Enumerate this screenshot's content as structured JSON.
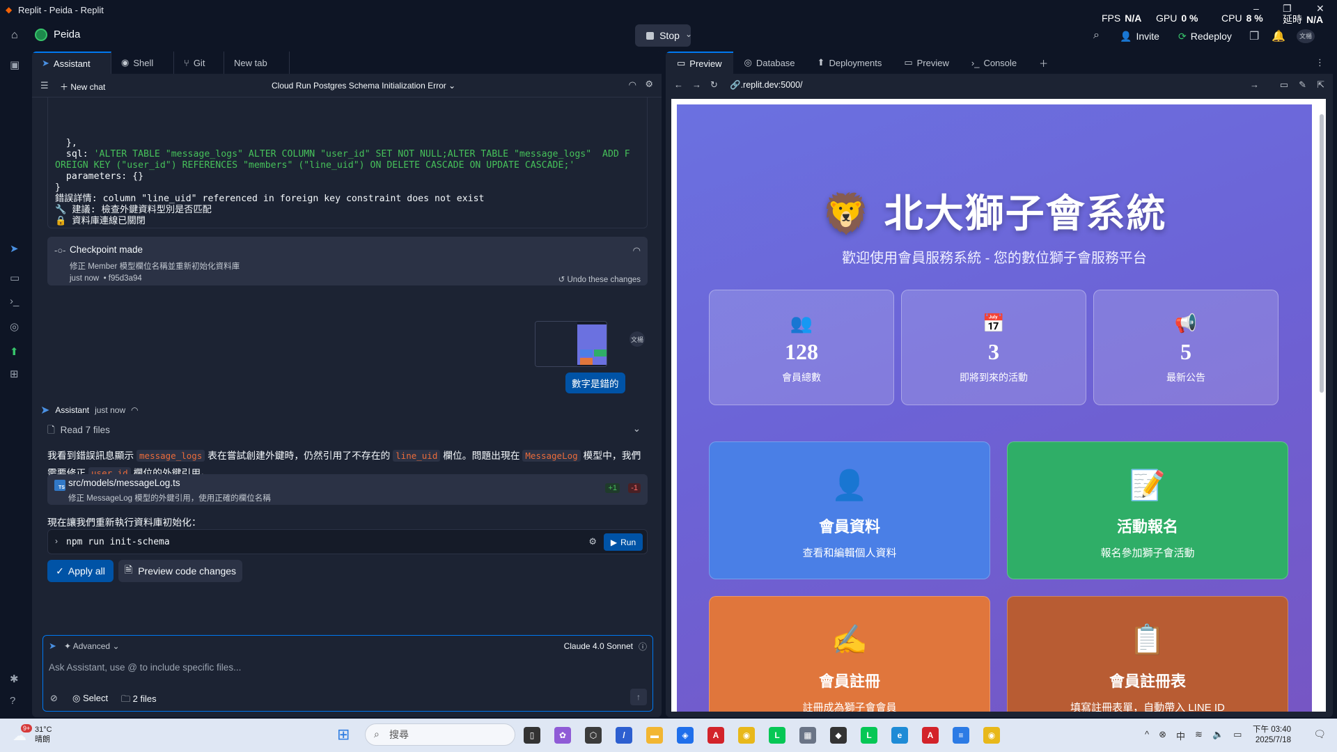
{
  "window": {
    "title": "Replit - Peida - Replit",
    "perf": [
      {
        "label": "FPS",
        "value": "N/A"
      },
      {
        "label": "GPU",
        "value": "0 %"
      },
      {
        "label": "CPU",
        "value": "8 %"
      },
      {
        "label": "延時",
        "value": "N/A"
      }
    ]
  },
  "header": {
    "repl_name": "Peida",
    "stop_label": "Stop",
    "invite_label": "Invite",
    "redeploy_label": "Redeploy",
    "avatar_text": "文楊"
  },
  "left": {
    "tabs": [
      {
        "label": "Assistant",
        "icon": "assistant-icon",
        "active": true
      },
      {
        "label": "Shell",
        "icon": "shell-icon"
      },
      {
        "label": "Git",
        "icon": "git-icon"
      },
      {
        "label": "New tab",
        "icon": ""
      }
    ],
    "new_chat": "New chat",
    "chat_title": "Cloud Run Postgres Schema Initialization Error",
    "code_lines": [
      "  },",
      "  sql: ",
      "'ALTER TABLE \"message_logs\" ALTER COLUMN \"user_id\" SET NOT NULL;ALTER TABLE \"message_logs\"  ADD F",
      "OREIGN KEY (\"user_id\") REFERENCES \"members\" (\"line_uid\") ON DELETE CASCADE ON UPDATE CASCADE;'",
      "  parameters: {}",
      "}",
      "錯誤詳情: column \"line_uid\" referenced in foreign key constraint does not exist",
      "🔧 建議: 檢查外鍵資料型別是否匹配",
      "🔒 資料庫連線已關閉"
    ],
    "checkpoint": {
      "title": "Checkpoint made",
      "desc": "修正 Member 模型欄位名稱並重新初始化資料庫",
      "time": "just now",
      "hash": "• f95d3a94",
      "undo": "Undo these changes"
    },
    "user_avatar": "文楊",
    "user_message": "數字是錯的",
    "assistant_name": "Assistant",
    "assistant_time": "just now",
    "read_files": "Read 7 files",
    "para1": {
      "a": "我看到錯誤訊息顯示 ",
      "b": "message_logs",
      "c": " 表在嘗試創建外鍵時，仍然引用了不存在的 ",
      "d": "line_uid",
      "e": " 欄位。問題出現在 ",
      "f": "MessageLog",
      "g": " 模型中，我們需要修正 ",
      "h": "user_id",
      "i": " 欄位的外鍵引用。"
    },
    "file": {
      "name": "src/models/messageLog.ts",
      "desc": "修正 MessageLog 模型的外鍵引用，使用正確的欄位名稱",
      "added": "+1",
      "removed": "-1",
      "badge": "TS"
    },
    "para2": "現在讓我們重新執行資料庫初始化：",
    "command": "npm run init-schema",
    "run_label": "Run",
    "apply_all": "Apply all",
    "preview_changes": "Preview code changes",
    "composer": {
      "advanced": "Advanced",
      "model": "Claude 4.0 Sonnet",
      "placeholder": "Ask Assistant, use @ to include specific files...",
      "select": "Select",
      "files": "2 files"
    }
  },
  "right": {
    "tabs": [
      {
        "label": "Preview",
        "active": true
      },
      {
        "label": "Database"
      },
      {
        "label": "Deployments"
      },
      {
        "label": "Preview"
      },
      {
        "label": "Console"
      }
    ],
    "url": ".replit.dev:5000/",
    "site": {
      "title": "🦁 北大獅子會系統",
      "subtitle": "歡迎使用會員服務系統 - 您的數位獅子會服務平台",
      "stats": [
        {
          "emoji": "👥",
          "value": "128",
          "label": "會員總數"
        },
        {
          "emoji": "📅",
          "value": "3",
          "label": "即將到來的活動"
        },
        {
          "emoji": "📢",
          "value": "5",
          "label": "最新公告"
        }
      ],
      "cards": [
        {
          "emoji": "👤",
          "title": "會員資料",
          "desc": "查看和編輯個人資料",
          "color": "#4a7fe6"
        },
        {
          "emoji": "📝",
          "title": "活動報名",
          "desc": "報名參加獅子會活動",
          "color": "#2fae67"
        },
        {
          "emoji": "✍️",
          "title": "會員註冊",
          "desc": "註冊成為獅子會會員",
          "color": "#e0763c"
        },
        {
          "emoji": "📋",
          "title": "會員註冊表",
          "desc": "填寫註冊表單，自動帶入 LINE ID",
          "color": "#b85c33"
        }
      ]
    }
  },
  "taskbar": {
    "temp": "31°C",
    "weather": "晴朗",
    "search": "搜尋",
    "ime": "中",
    "time": "下午 03:40",
    "date": "2025/7/18",
    "badge": "9+"
  }
}
